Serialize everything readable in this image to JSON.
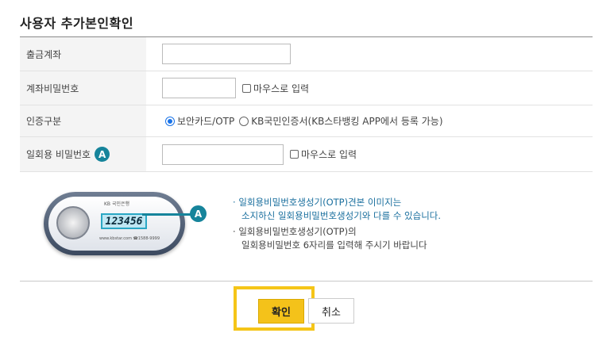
{
  "page_title": "사용자 추가본인확인",
  "form": {
    "withdraw_account": {
      "label": "출금계좌",
      "value": ""
    },
    "account_password": {
      "label": "계좌비밀번호",
      "value": "",
      "mouse_input_label": "마우스로 입력"
    },
    "auth_type": {
      "label": "인증구분",
      "options": [
        {
          "label": "보안카드/OTP",
          "selected": true
        },
        {
          "label": "KB국민인증서(KB스타뱅킹 APP에서 등록 가능)",
          "selected": false
        }
      ]
    },
    "otp_password": {
      "label": "일회용 비밀번호",
      "badge": "A",
      "value": "",
      "mouse_input_label": "마우스로 입력"
    }
  },
  "otp_device": {
    "brand": "KB 국민은행",
    "display": "123456",
    "url": "www.kbstar.com  ☎1588-9999",
    "badge": "A"
  },
  "notes": [
    {
      "bullet": "·",
      "lines": [
        "일회용비밀번호생성기(OTP)견본 이미지는",
        "소지하신 일회용비밀번호생성기와 다를 수 있습니다."
      ],
      "color": "#1a6f9e"
    },
    {
      "bullet": "·",
      "lines": [
        "일회용비밀번호생성기(OTP)의",
        "일회용비밀번호 6자리를 입력해 주시기 바랍니다"
      ],
      "color": "#444444"
    }
  ],
  "buttons": {
    "confirm": "확인",
    "cancel": "취소"
  },
  "colors": {
    "accent": "#f4c21a",
    "highlight": "#f5c518",
    "badge": "#16849b",
    "radio": "#1a73e8"
  }
}
